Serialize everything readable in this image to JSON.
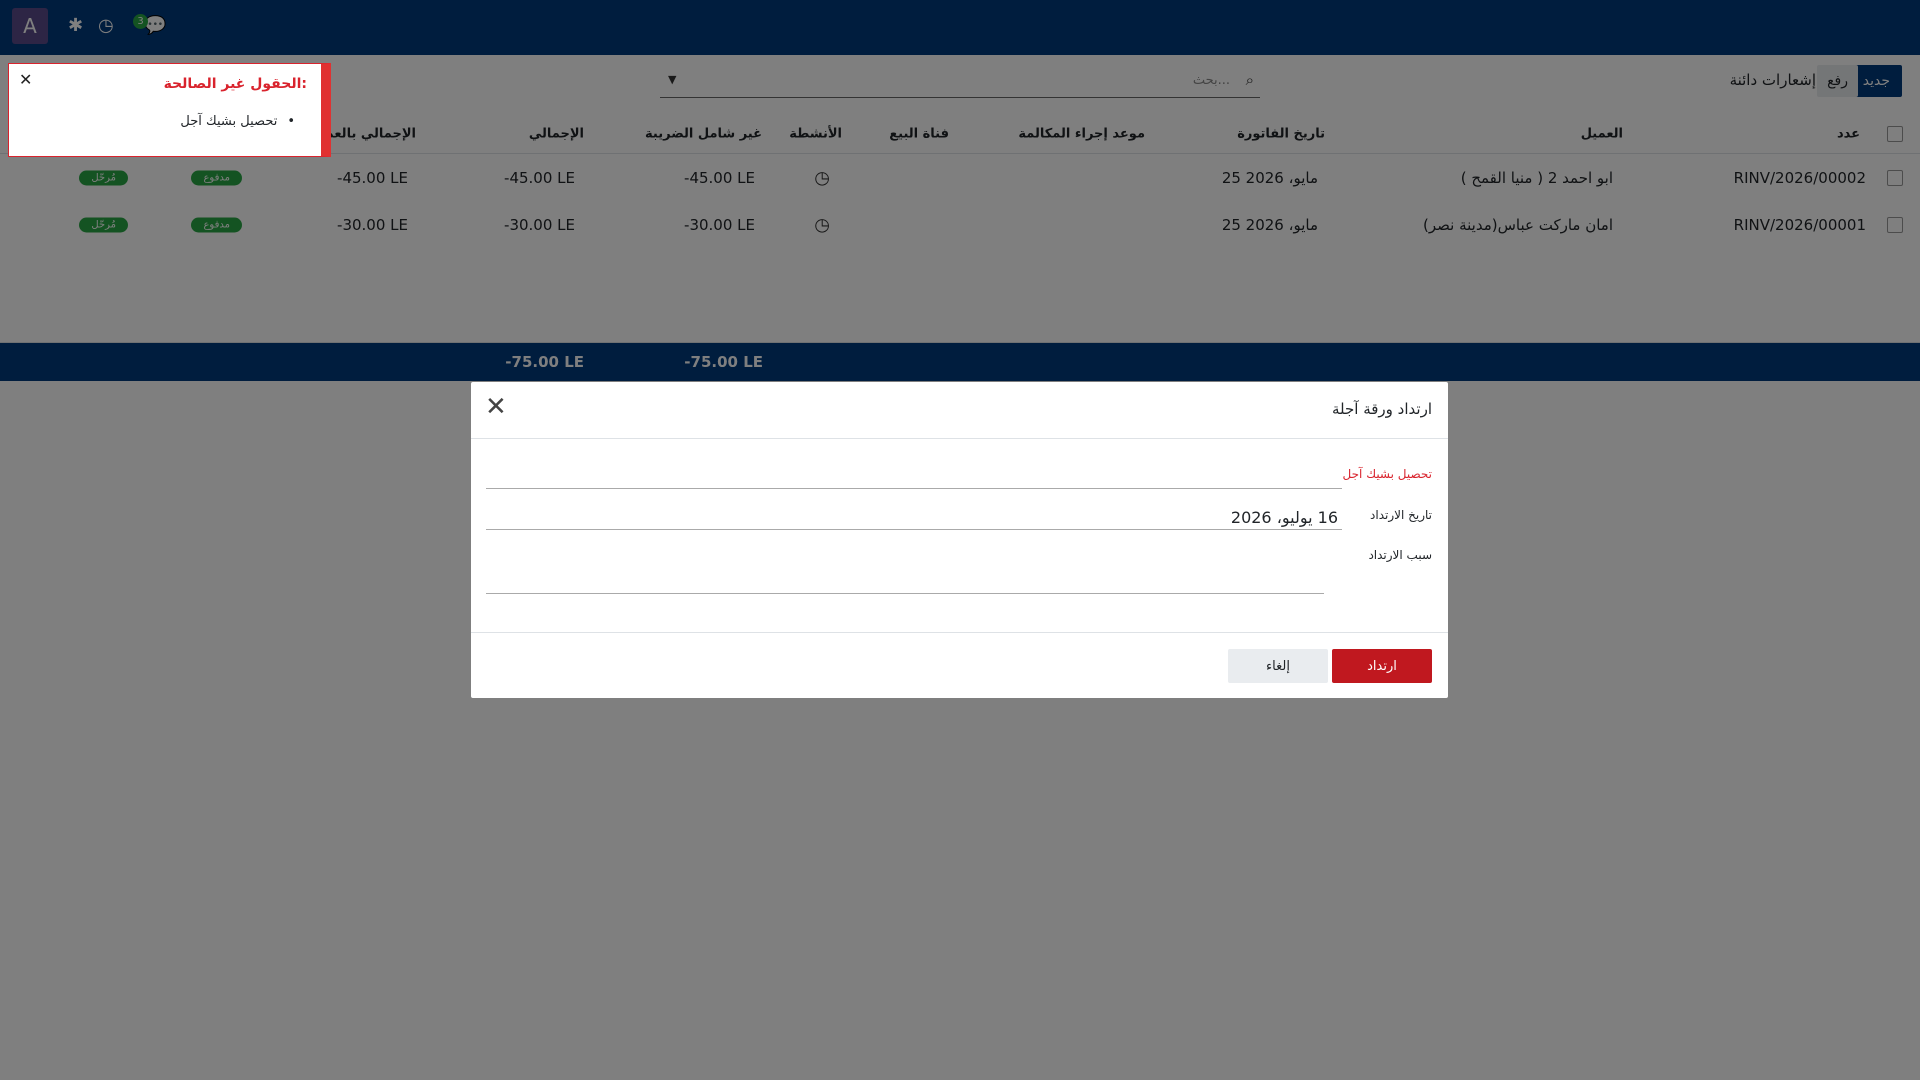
{
  "navbar": {
    "avatar_letter": "A",
    "message_count": "3",
    "icons": [
      "chat-icon",
      "clock-icon",
      "bug-icon"
    ]
  },
  "control_panel": {
    "new_label": "جديد",
    "upload_label": "رفع",
    "breadcrumb": "إشعارات دائنة",
    "search_placeholder": "بحث..."
  },
  "table": {
    "headers": {
      "number": "عدد",
      "customer": "العميل",
      "invoice_date": "تاريخ الفاتورة",
      "next_activity": "موعد إجراء المكالمة",
      "sales_channel": "فناة البيع",
      "activities": "الأنشطة",
      "untaxed": "غير شامل الضريبة",
      "total": "الإجمالي",
      "total_currency": "الإجمالي بالعملة"
    },
    "rows": [
      {
        "number": "RINV/2026/00002",
        "customer": "ابو احمد 2 ( منيا القمح )",
        "date": "25 مايو، 2026",
        "untaxed": "-45.00 LE",
        "total": "-45.00 LE",
        "total_currency": "-45.00 LE",
        "payment_state": "مدفوع",
        "state": "مُرحّل"
      },
      {
        "number": "RINV/2026/00001",
        "customer": "امان ماركت عباس(مدينة نصر)",
        "date": "25 مايو، 2026",
        "untaxed": "-30.00 LE",
        "total": "-30.00 LE",
        "total_currency": "-30.00 LE",
        "payment_state": "مدفوع",
        "state": "مُرحّل"
      }
    ],
    "footer": {
      "untaxed_total": "-75.00 LE",
      "grand_total": "-75.00 LE"
    }
  },
  "modal": {
    "title": "ارتداد ورقة آجلة",
    "fields": {
      "journal_label": "تحصيل بشيك آجل",
      "date_label": "تاريخ الارتداد",
      "date_value": "16 يوليو، 2026",
      "reason_label": "سبب الارتداد"
    },
    "confirm_label": "ارتداد",
    "cancel_label": "إلغاء"
  },
  "notification": {
    "title": "الحقول غير الصالحة:",
    "item": "تحصيل بشيك آجل"
  }
}
